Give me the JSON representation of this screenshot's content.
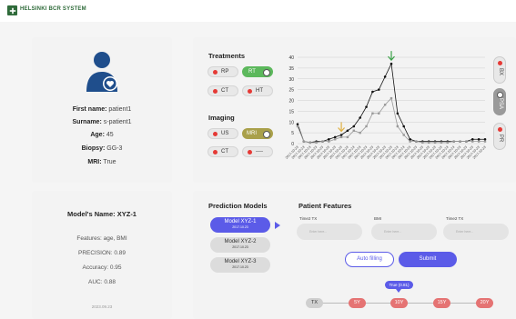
{
  "app": {
    "title": "HELSINKI BCR SYSTEM"
  },
  "patient": {
    "first_name_label": "First name:",
    "first_name": "patient1",
    "surname_label": "Surname:",
    "surname": "s-patient1",
    "age_label": "Age:",
    "age": "45",
    "biopsy_label": "Biopsy:",
    "biopsy": "GG-3",
    "mri_label": "MRI:",
    "mri": "True"
  },
  "model_card": {
    "title": "Model's Name: XYZ-1",
    "features": "Features: age, BMI",
    "precision": "PRECISION: 0.89",
    "accuracy": "Accuracy: 0.95",
    "auc": "AUC: 0.88",
    "date": "2023.09.23"
  },
  "treatments": {
    "title": "Treatments",
    "chips": [
      {
        "label": "RP",
        "on": false
      },
      {
        "label": "RT",
        "on": true
      },
      {
        "label": "CT",
        "on": false
      },
      {
        "label": "HT",
        "on": false
      }
    ]
  },
  "imaging": {
    "title": "Imaging",
    "chips": [
      {
        "label": "US",
        "on": false
      },
      {
        "label": "MRI",
        "on": true
      },
      {
        "label": "CT",
        "on": false
      },
      {
        "label": "----",
        "on": false
      }
    ]
  },
  "side_tabs": [
    {
      "label": "BX",
      "active": false
    },
    {
      "label": "PSA",
      "active": true
    },
    {
      "label": "PR",
      "active": false
    }
  ],
  "chart_data": {
    "type": "line",
    "ylim": [
      0,
      40
    ],
    "yticks": [
      0,
      5,
      10,
      15,
      20,
      25,
      30,
      35,
      40
    ],
    "x": [
      "2017-10-23",
      "2017-10-23",
      "2017-10-23",
      "2017-10-23",
      "2017-10-23",
      "2017-10-23",
      "2017-10-23",
      "2017-10-23",
      "2017-10-23",
      "2017-10-23",
      "2017-10-23",
      "2017-10-23",
      "2017-10-23",
      "2017-10-23",
      "2017-10-23",
      "2017-10-23",
      "2017-10-23",
      "2017-10-23",
      "2017-10-23",
      "2017-10-23",
      "2017-10-23",
      "2017-10-23",
      "2017-10-23",
      "2017-10-23",
      "2017-10-23",
      "2017-10-23",
      "2017-10-23",
      "2017-10-23",
      "2017-10-23",
      "2017-10-23",
      "2017-10-23"
    ],
    "series": [
      {
        "color": "#111111",
        "values": [
          9,
          1,
          0.5,
          1,
          1,
          2,
          3,
          4,
          6,
          8,
          12,
          17,
          24,
          25,
          31,
          37,
          14,
          8,
          2,
          1,
          1,
          1,
          1,
          1,
          1,
          1,
          1,
          1,
          2,
          2,
          2
        ]
      },
      {
        "color": "#999999",
        "values": [
          8,
          1,
          0.5,
          0.5,
          1,
          1,
          2,
          3,
          3,
          6,
          5,
          8,
          14,
          14,
          18,
          21,
          8,
          4,
          1,
          1,
          0.5,
          0.5,
          0.5,
          0.5,
          0.5,
          1,
          1,
          1,
          1,
          1,
          1
        ]
      }
    ],
    "markers": [
      {
        "index": 7,
        "color": "#e0b040"
      },
      {
        "index": 15,
        "color": "#3aa048"
      }
    ]
  },
  "prediction": {
    "title": "Prediction Models",
    "models": [
      {
        "name": "Model XYZ-1",
        "date": "2017.10.23",
        "selected": true
      },
      {
        "name": "Model XYZ-2",
        "date": "2017.10.23",
        "selected": false
      },
      {
        "name": "Model XYZ-3",
        "date": "2017.10.23",
        "selected": false
      }
    ]
  },
  "features": {
    "title": "Patient Features",
    "fields": [
      {
        "label": "Time2 TX",
        "placeholder": "Enter here..."
      },
      {
        "label": "BMI",
        "placeholder": "Enter here..."
      },
      {
        "label": "Time2 TX",
        "placeholder": "Enter here..."
      }
    ],
    "autofill_label": "Auto filling",
    "submit_label": "Submit"
  },
  "timeline": {
    "flag": "True (0.81)",
    "points": [
      "TX",
      "5Y",
      "10Y",
      "15Y",
      "20Y"
    ]
  }
}
